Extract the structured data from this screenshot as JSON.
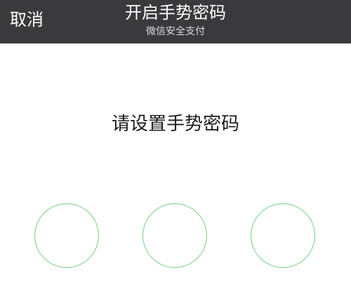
{
  "header": {
    "cancel_label": "取消",
    "title": "开启手势密码",
    "subtitle": "微信安全支付"
  },
  "main": {
    "prompt": "请设置手势密码"
  },
  "colors": {
    "header_background": "#3a3a3c",
    "circle_stroke": "#6fcf7a",
    "page_background": "#ffffff"
  }
}
